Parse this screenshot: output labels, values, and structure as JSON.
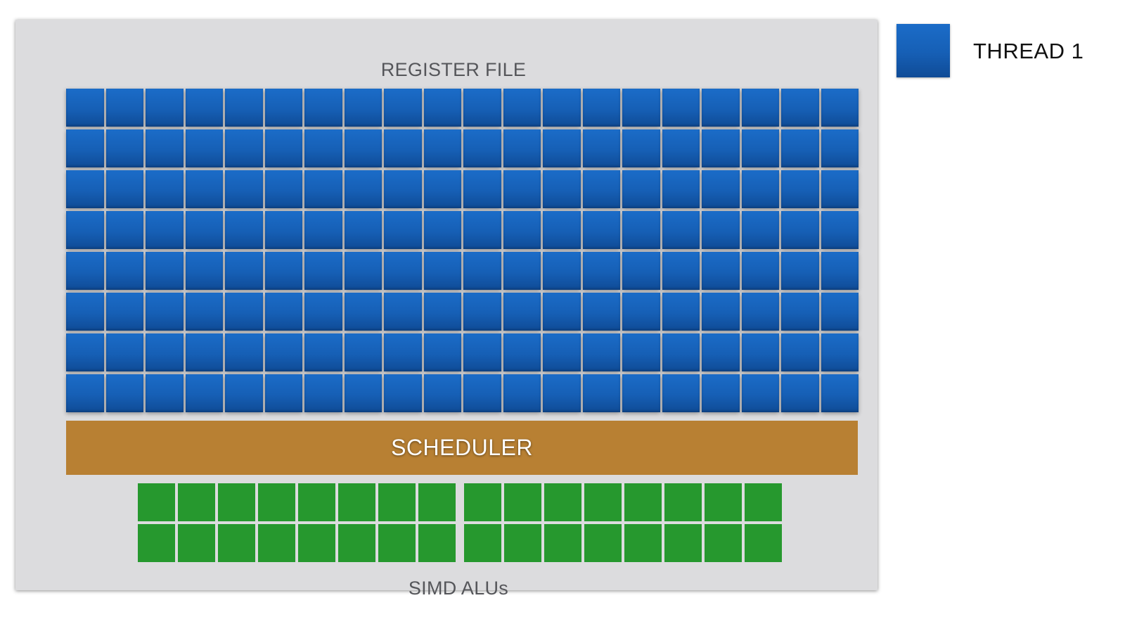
{
  "register_file": {
    "label": "REGISTER FILE"
  },
  "scheduler": {
    "label": "SCHEDULER"
  },
  "simd": {
    "label": "SIMD ALUs"
  },
  "legend": {
    "label": "THREAD 1"
  },
  "grid": {
    "register_file": {
      "columns": 20,
      "rows": 8
    },
    "alu_block": {
      "count": 2,
      "columns": 8,
      "rows": 2
    }
  },
  "colors": {
    "thread_1": "#165fb5",
    "scheduler": "#b88033",
    "alu": "#26982e",
    "panel": "#dcdcde"
  }
}
